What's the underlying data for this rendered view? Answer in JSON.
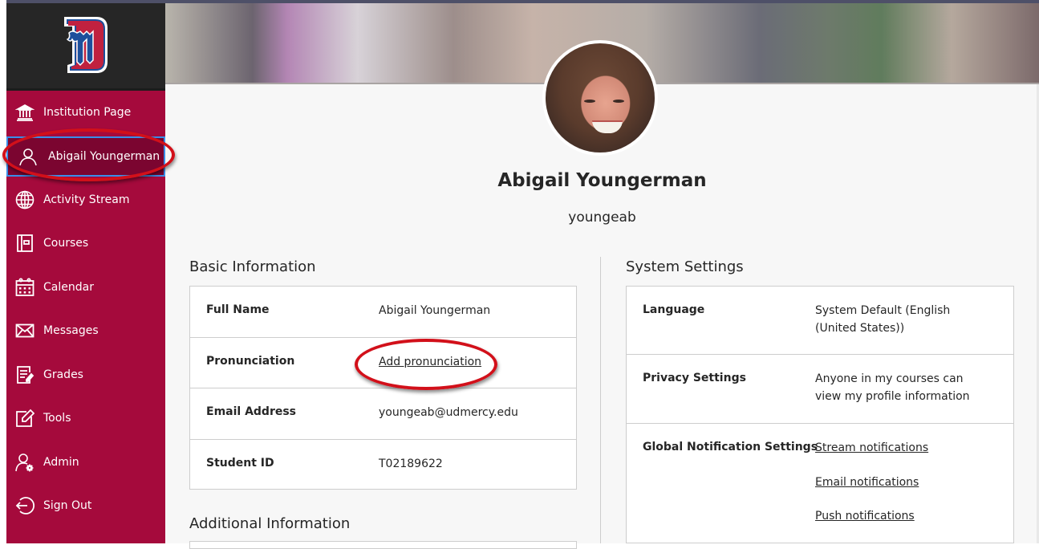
{
  "sidebar": {
    "logo": "University of Detroit Mercy logo",
    "items": [
      {
        "label": "Institution Page",
        "icon": "institution-icon",
        "active": false
      },
      {
        "label": "Abigail Youngerman",
        "icon": "user-icon",
        "active": true
      },
      {
        "label": "Activity Stream",
        "icon": "globe-icon",
        "active": false
      },
      {
        "label": "Courses",
        "icon": "courses-icon",
        "active": false
      },
      {
        "label": "Calendar",
        "icon": "calendar-icon",
        "active": false
      },
      {
        "label": "Messages",
        "icon": "envelope-icon",
        "active": false
      },
      {
        "label": "Grades",
        "icon": "grades-icon",
        "active": false
      },
      {
        "label": "Tools",
        "icon": "tools-icon",
        "active": false
      },
      {
        "label": "Admin",
        "icon": "admin-icon",
        "active": false
      },
      {
        "label": "Sign Out",
        "icon": "sign-out-icon",
        "active": false
      }
    ]
  },
  "profile": {
    "name": "Abigail Youngerman",
    "username": "youngeab"
  },
  "basic_info": {
    "title": "Basic Information",
    "rows": [
      {
        "label": "Full Name",
        "value": "Abigail Youngerman"
      },
      {
        "label": "Pronunciation",
        "value": "Add pronunciation"
      },
      {
        "label": "Email Address",
        "value": "youngeab@udmercy.edu"
      },
      {
        "label": "Student ID",
        "value": "T02189622"
      }
    ]
  },
  "additional_info": {
    "title": "Additional Information"
  },
  "system_settings": {
    "title": "System Settings",
    "language": {
      "label": "Language",
      "value_line1": "System Default (English",
      "value_line2": "(United States))"
    },
    "privacy": {
      "label": "Privacy Settings",
      "value_line1": "Anyone in my courses can",
      "value_line2": "view my profile information"
    },
    "notifications": {
      "label": "Global Notification Settings",
      "links": [
        "Stream notifications",
        "Email notifications",
        "Push notifications"
      ]
    }
  },
  "colors": {
    "sidebar_bg": "#a50a3c",
    "sidebar_active_bg": "#7b0530",
    "link": "#2a77a8",
    "annotation": "#d2101a"
  }
}
